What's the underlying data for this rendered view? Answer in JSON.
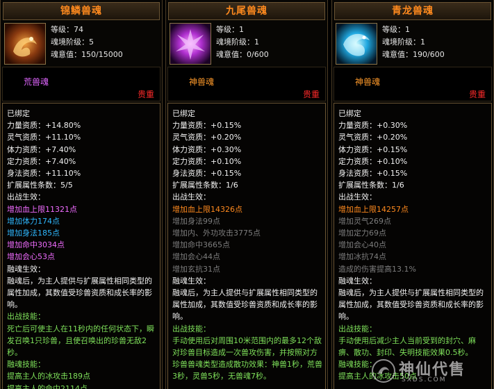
{
  "cards": [
    {
      "name": "锦鳞兽魂",
      "level": "等级：74",
      "realm": "魂境阶级：5",
      "soul": "魂意值：150/15000",
      "rarity": "荒兽魂",
      "rarity_color": "#e066ff",
      "quality": "贵重",
      "lines": [
        {
          "t": "已绑定",
          "c": "white"
        },
        {
          "t": "力量资质：+14.80%",
          "c": "white"
        },
        {
          "t": "灵气资质：+11.10%",
          "c": "white"
        },
        {
          "t": "体力资质：+7.40%",
          "c": "white"
        },
        {
          "t": "定力资质：+7.40%",
          "c": "white"
        },
        {
          "t": "身法资质：+11.10%",
          "c": "white"
        },
        {
          "t": "扩展属性条数：5/5",
          "c": "white"
        },
        {
          "t": "出战生效：",
          "c": "white"
        },
        {
          "t": "增加血上限11321点",
          "c": "pink"
        },
        {
          "t": "增加体力174点",
          "c": "cyan"
        },
        {
          "t": "增加身法185点",
          "c": "cyan"
        },
        {
          "t": "增加命中3034点",
          "c": "pink"
        },
        {
          "t": "增加会心53点",
          "c": "pink"
        },
        {
          "t": "融魂生效：",
          "c": "white"
        },
        {
          "t": "融魂后，为主人提供与扩展属性相同类型的属性加成，其数值受珍兽资质和成长率的影响。",
          "c": "white",
          "wrap": true
        },
        {
          "t": "出战技能：",
          "c": "green"
        },
        {
          "t": "死亡后可使主人在11秒内的任何状态下，瞬发召唤1只珍兽，且使召唤出的珍兽无敌2秒。",
          "c": "green",
          "wrap": true
        },
        {
          "t": "融魂技能：",
          "c": "green"
        },
        {
          "t": "提高主人的冰攻击189点",
          "c": "green"
        },
        {
          "t": "提高主人的命中2114点",
          "c": "green"
        }
      ]
    },
    {
      "name": "九尾兽魂",
      "level": "等级：1",
      "realm": "魂境阶级：1",
      "soul": "魂意值：0/600",
      "rarity": "神兽魂",
      "rarity_color": "#ff9a2a",
      "quality": "贵重",
      "lines": [
        {
          "t": "已绑定",
          "c": "white"
        },
        {
          "t": "力量资质：+0.15%",
          "c": "white"
        },
        {
          "t": "灵气资质：+0.20%",
          "c": "white"
        },
        {
          "t": "体力资质：+0.30%",
          "c": "white"
        },
        {
          "t": "定力资质：+0.10%",
          "c": "white"
        },
        {
          "t": "身法资质：+0.15%",
          "c": "white"
        },
        {
          "t": "扩展属性条数：1/6",
          "c": "white"
        },
        {
          "t": "出战生效：",
          "c": "white"
        },
        {
          "t": "增加血上限14326点",
          "c": "orange"
        },
        {
          "t": "增加身法99点",
          "c": "gray"
        },
        {
          "t": "增加内、外功攻击3775点",
          "c": "gray"
        },
        {
          "t": "增加命中3665点",
          "c": "gray"
        },
        {
          "t": "增加会心44点",
          "c": "gray"
        },
        {
          "t": "增加玄抗31点",
          "c": "gray"
        },
        {
          "t": "融魂生效：",
          "c": "white"
        },
        {
          "t": "融魂后，为主人提供与扩展属性相同类型的属性加成，其数值受珍兽资质和成长率的影响。",
          "c": "white",
          "wrap": true
        },
        {
          "t": "出战技能：",
          "c": "green"
        },
        {
          "t": "手动使用后对周围10米范围内的最多12个敌对珍兽目标造成一次兽攻伤害，并按照对方珍兽兽魂类型造成散功效果：神兽1秒，荒兽3秒，灵兽5秒，无兽魂7秒。",
          "c": "green",
          "wrap": true
        }
      ]
    },
    {
      "name": "青龙兽魂",
      "level": "等级：1",
      "realm": "魂境阶级：1",
      "soul": "魂意值：190/600",
      "rarity": "神兽魂",
      "rarity_color": "#ff9a2a",
      "quality": "贵重",
      "lines": [
        {
          "t": "已绑定",
          "c": "white"
        },
        {
          "t": "力量资质：+0.30%",
          "c": "white"
        },
        {
          "t": "灵气资质：+0.20%",
          "c": "white"
        },
        {
          "t": "体力资质：+0.15%",
          "c": "white"
        },
        {
          "t": "定力资质：+0.10%",
          "c": "white"
        },
        {
          "t": "身法资质：+0.15%",
          "c": "white"
        },
        {
          "t": "扩展属性条数：1/6",
          "c": "white"
        },
        {
          "t": "出战生效：",
          "c": "white"
        },
        {
          "t": "增加血上限14257点",
          "c": "orange"
        },
        {
          "t": "增加灵气269点",
          "c": "gray"
        },
        {
          "t": "增加定力69点",
          "c": "gray"
        },
        {
          "t": "增加会心40点",
          "c": "gray"
        },
        {
          "t": "增加冰抗74点",
          "c": "gray"
        },
        {
          "t": "造成的伤害提高13.1%",
          "c": "gray"
        },
        {
          "t": "融魂生效：",
          "c": "white"
        },
        {
          "t": "融魂后，为主人提供与扩展属性相同类型的属性加成，其数值受珍兽资质和成长率的影响。",
          "c": "white",
          "wrap": true
        },
        {
          "t": "出战技能：",
          "c": "green"
        },
        {
          "t": "手动使用后减少主人当前受到的封穴、麻痹、散功、封印、失明技能效果0.5秒。",
          "c": "green",
          "wrap": true
        },
        {
          "t": "融魂技能：",
          "c": "green"
        },
        {
          "t": "提高主人的冰攻击50点",
          "c": "green"
        }
      ]
    }
  ],
  "watermark": {
    "text": "神仙代售",
    "url": "SXDS.COM"
  }
}
